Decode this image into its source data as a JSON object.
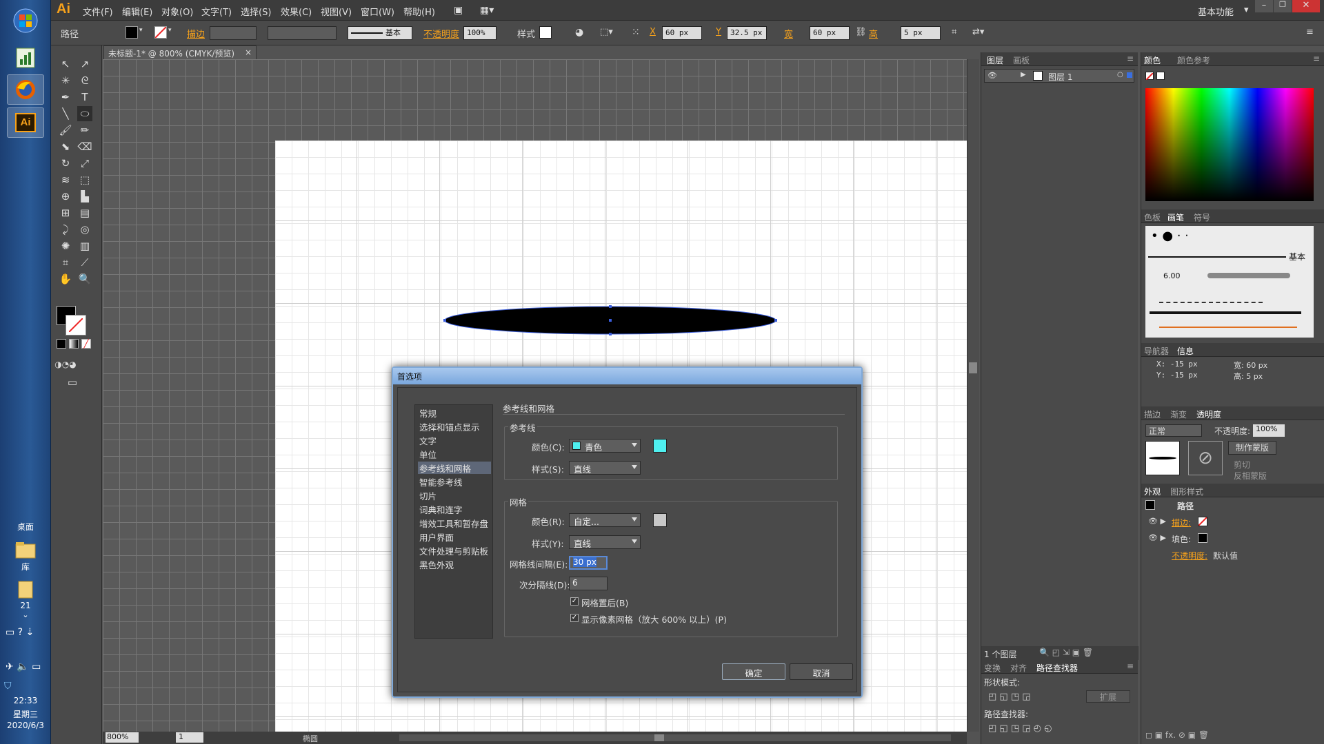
{
  "taskbar": {
    "desktop_label": "桌面",
    "library_label": "库",
    "num_21": "21",
    "time": "22:33",
    "weekday": "星期三",
    "date": "2020/6/3"
  },
  "menubar": {
    "logo": "Ai",
    "items": [
      "文件(F)",
      "编辑(E)",
      "对象(O)",
      "文字(T)",
      "选择(S)",
      "效果(C)",
      "视图(V)",
      "窗口(W)",
      "帮助(H)"
    ],
    "workspace": "基本功能"
  },
  "control": {
    "object_type": "路径",
    "stroke_label": "描边",
    "stroke_style": "基本",
    "opacity_label": "不透明度",
    "opacity": "100%",
    "style_label": "样式",
    "x_label": "X",
    "x": "60 px",
    "y_label": "Y",
    "y": "32.5 px",
    "w_label": "宽",
    "w": "60 px",
    "h_label": "高",
    "h": "5 px"
  },
  "doc_tab": {
    "title": "未标题-1* @ 800% (CMYK/预览)",
    "close": "×"
  },
  "status": {
    "zoom": "800%",
    "page": "1",
    "tool": "椭圆"
  },
  "layers": {
    "tab1": "图层",
    "tab2": "画板",
    "layer_name": "图层 1",
    "count": "1 个图层"
  },
  "pathfinder": {
    "tab1": "变换",
    "tab2": "对齐",
    "tab3": "路径查找器",
    "shape_modes": "形状模式:",
    "expand": "扩展",
    "pathfinders": "路径查找器:"
  },
  "color_panel": {
    "tab1": "颜色",
    "tab2": "颜色参考"
  },
  "brush_panel": {
    "tab1": "色板",
    "tab2": "画笔",
    "tab3": "符号",
    "basic": "基本",
    "size": "6.00"
  },
  "nav_panel": {
    "tab1": "导航器",
    "tab2": "信息",
    "x": "X: -15 px",
    "y": "Y: -15 px",
    "w": "宽: 60 px",
    "h": "高: 5 px"
  },
  "transparency": {
    "tab1": "描边",
    "tab2": "渐变",
    "tab3": "透明度",
    "mode": "正常",
    "opacity_label": "不透明度:",
    "opacity": "100%",
    "make_mask": "制作蒙版",
    "clip": "剪切",
    "invert": "反相蒙版"
  },
  "appearance": {
    "tab1": "外观",
    "tab2": "图形样式",
    "title": "路径",
    "stroke": "描边:",
    "fill": "填色:",
    "opacity": "不透明度:",
    "opacity_value": "默认值"
  },
  "dialog": {
    "title": "首选项",
    "categories": [
      "常规",
      "选择和锚点显示",
      "文字",
      "单位",
      "参考线和网格",
      "智能参考线",
      "切片",
      "词典和连字",
      "增效工具和暂存盘",
      "用户界面",
      "文件处理与剪贴板",
      "黑色外观"
    ],
    "selected_index": 4,
    "section_title": "参考线和网格",
    "guides": {
      "group": "参考线",
      "color_label": "颜色(C):",
      "color_value": "青色",
      "color_hex": "#4ff0f0",
      "style_label": "样式(S):",
      "style_value": "直线"
    },
    "grid": {
      "group": "网格",
      "color_label": "颜色(R):",
      "color_value": "自定...",
      "color_hex": "#c8c8c8",
      "style_label": "样式(Y):",
      "style_value": "直线",
      "spacing_label": "网格线间隔(E):",
      "spacing_value": "30 px",
      "subdiv_label": "次分隔线(D):",
      "subdiv_value": "6",
      "back_label": "网格置后(B)",
      "back_checked": true,
      "pixel_label": "显示像素网格（放大 600% 以上）(P)",
      "pixel_checked": true
    },
    "ok": "确定",
    "cancel": "取消"
  }
}
